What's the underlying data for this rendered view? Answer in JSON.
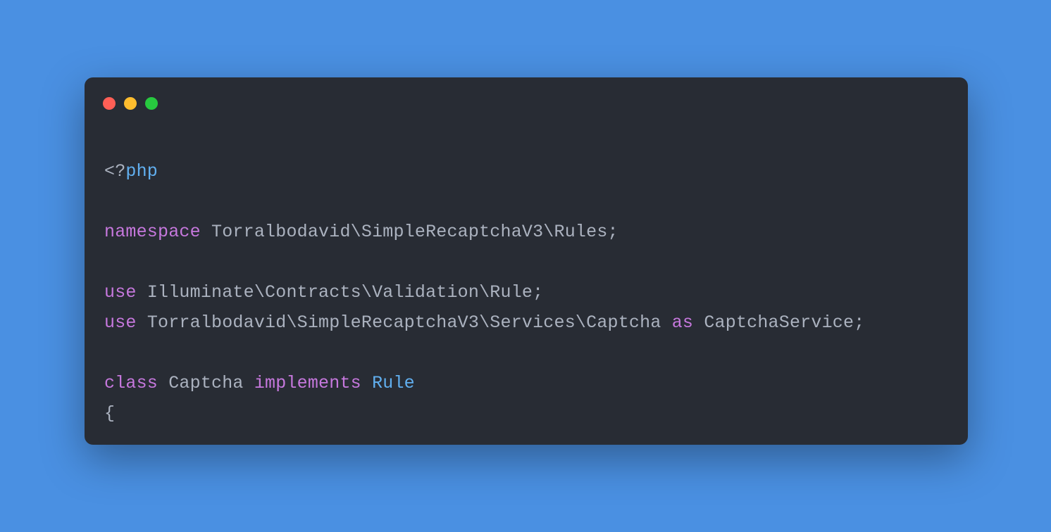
{
  "colors": {
    "background": "#4a90e2",
    "window": "#282c34",
    "dot_red": "#ff5f56",
    "dot_yellow": "#ffbd2e",
    "dot_green": "#27c93f",
    "text_default": "#abb2bf",
    "text_keyword": "#c678dd",
    "text_type": "#61afef"
  },
  "code": {
    "l1_open": "<?",
    "l1_php": "php",
    "l3_ns_kw": "namespace",
    "l3_ns_sp": " ",
    "l3_ns_val": "Torralbodavid\\SimpleRecaptchaV3\\Rules",
    "l3_ns_semi": ";",
    "l5_use_kw": "use",
    "l5_use_sp": " ",
    "l5_use_val": "Illuminate\\Contracts\\Validation\\Rule",
    "l5_use_semi": ";",
    "l6_use_kw": "use",
    "l6_use_sp": " ",
    "l6_use_val": "Torralbodavid\\SimpleRecaptchaV3\\Services\\Captcha",
    "l6_use_sp2": " ",
    "l6_as_kw": "as",
    "l6_as_sp": " ",
    "l6_alias": "CaptchaService",
    "l6_use_semi": ";",
    "l8_class_kw": "class",
    "l8_class_sp": " ",
    "l8_class_name": "Captcha",
    "l8_class_sp2": " ",
    "l8_impl_kw": "implements",
    "l8_impl_sp": " ",
    "l8_impl_type": "Rule",
    "l9_brace": "{"
  }
}
